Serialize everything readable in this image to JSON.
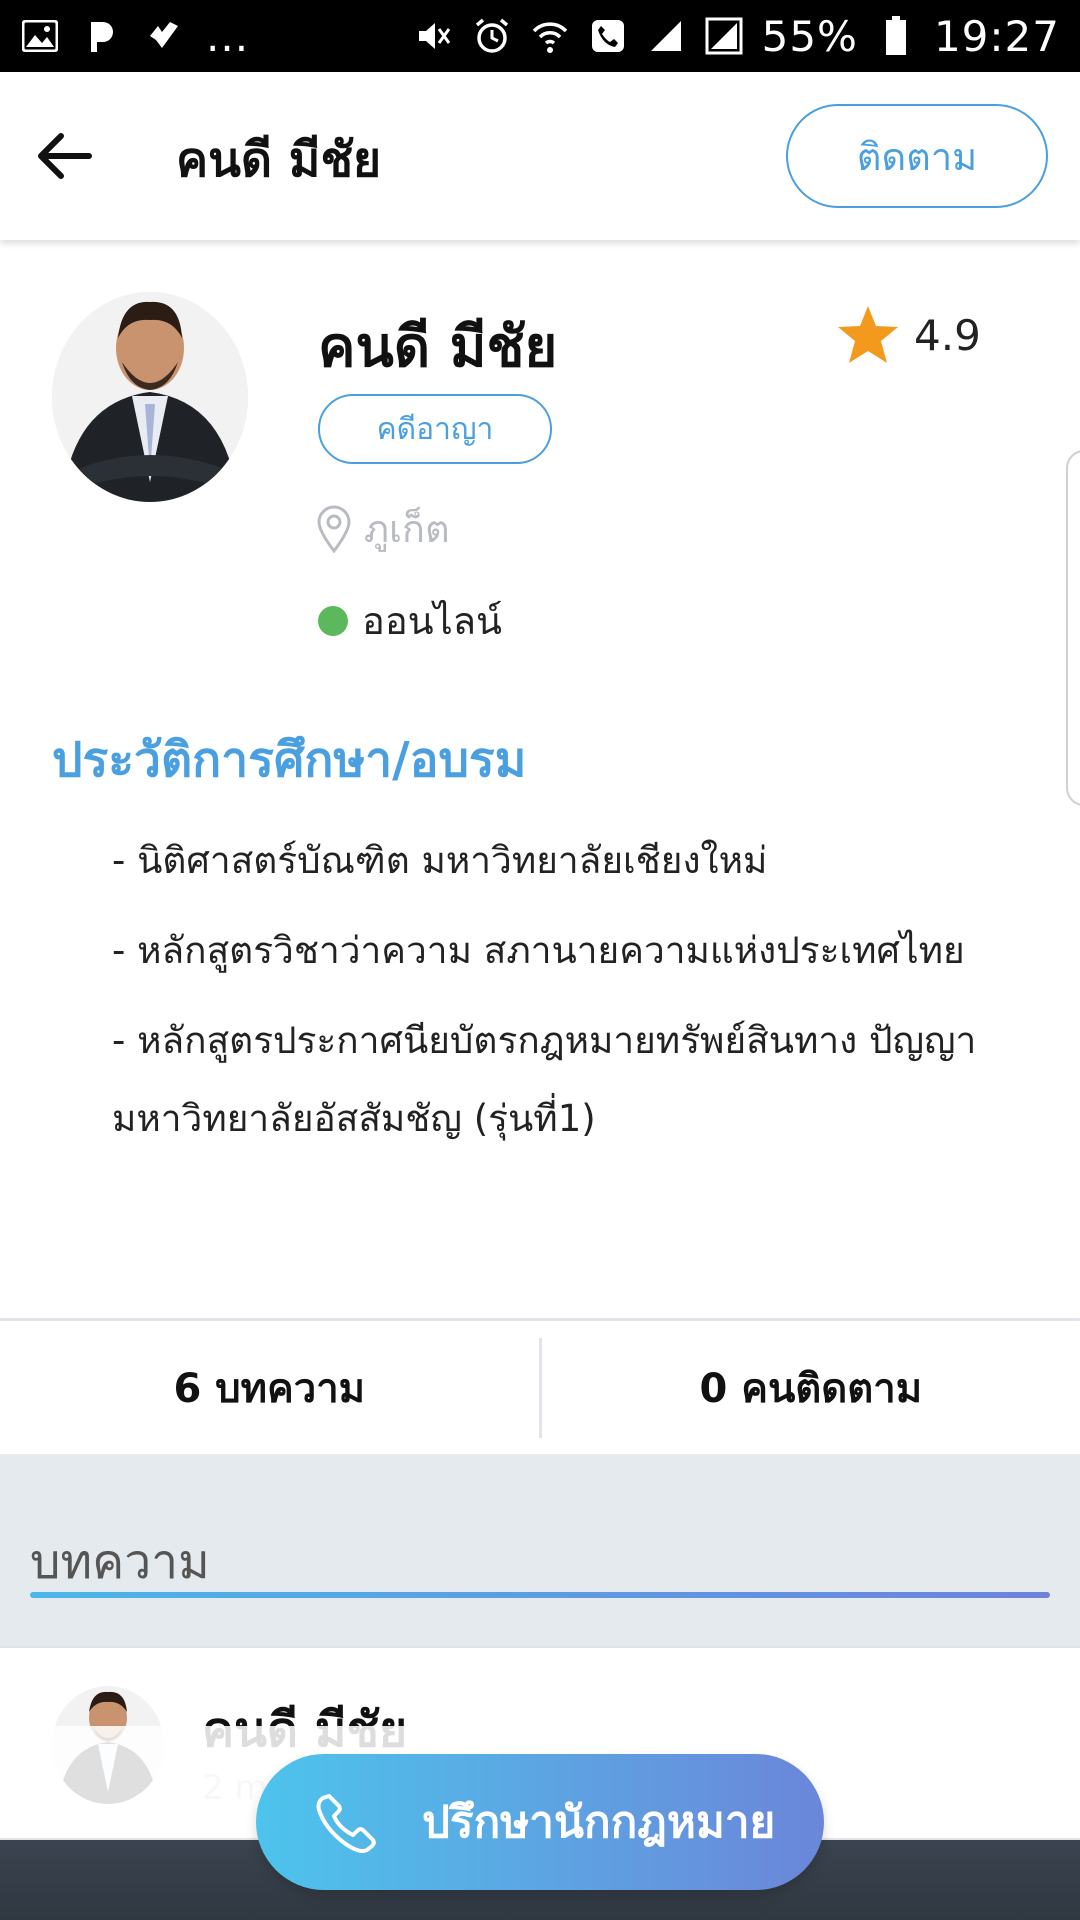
{
  "status_bar": {
    "notifications_more": "...",
    "battery_percent": "55%",
    "time": "19:27"
  },
  "app_bar": {
    "title": "คนดี มีชัย",
    "follow_label": "ติดตาม"
  },
  "profile": {
    "name": "คนดี มีชัย",
    "rating": "4.9",
    "category": "คดีอาญา",
    "location": "ภูเก็ต",
    "status": "ออนไลน์"
  },
  "education": {
    "title": "ประวัติการศึกษา/อบรม",
    "items": [
      "- นิติศาสตร์บัณฑิต มหาวิทยาลัยเชียงใหม่",
      "- หลักสูตรวิชาว่าความ สภานายความแห่งประเทศไทย",
      "- หลักสูตรประกาศนียบัตรกฎหมายทรัพย์สินทาง ปัญญา มหาวิทยาลัยอัสสัมชัญ (รุ่นที่1)"
    ]
  },
  "stats": {
    "articles": "6 บทความ",
    "followers": "0 คนติดตาม"
  },
  "articles": {
    "section_title": "บทความ",
    "first_card": {
      "author": "คนดี มีชัย",
      "date": "2 m"
    }
  },
  "cta": {
    "label": "ปรึกษานักกฎหมาย"
  },
  "colors": {
    "accent": "#4a9fe0",
    "online": "#5cb85c",
    "star": "#f39a1e"
  }
}
